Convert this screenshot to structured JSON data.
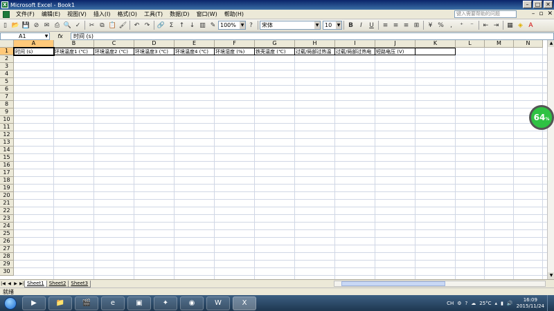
{
  "window": {
    "title": "Microsoft Excel - Book1",
    "app_letter": "X"
  },
  "menu": {
    "items": [
      "文件(F)",
      "编辑(E)",
      "视图(V)",
      "插入(I)",
      "格式(O)",
      "工具(T)",
      "数据(D)",
      "窗口(W)",
      "帮助(H)"
    ],
    "help_placeholder": "键入需要帮助的问题"
  },
  "toolbar": {
    "zoom": "100%",
    "font": "宋体",
    "font_size": "10",
    "bold": "B",
    "italic": "I",
    "underline": "U",
    "percent": "%",
    "sum": "Σ"
  },
  "formula_bar": {
    "name_box": "A1",
    "fx": "fx",
    "content": "时间 (s)"
  },
  "sheet": {
    "columns": [
      "A",
      "B",
      "C",
      "D",
      "E",
      "F",
      "G",
      "H",
      "I",
      "J",
      "K",
      "L",
      "M",
      "N"
    ],
    "rows": [
      "1",
      "2",
      "3",
      "4",
      "5",
      "6",
      "7",
      "8",
      "9",
      "10",
      "11",
      "12",
      "13",
      "14",
      "15",
      "16",
      "17",
      "18",
      "19",
      "20",
      "21",
      "22",
      "23",
      "24",
      "25",
      "26",
      "27",
      "28",
      "29",
      "30"
    ],
    "row1": [
      "时间 (s)",
      "环境温度1 (℃)",
      "环境温度2 (℃)",
      "环境温度3 (℃)",
      "环境温度4 (℃)",
      "环境湿度 (%)",
      "铁壳温度 (℃)",
      "过载/局部过热温",
      "过载/局部过热电",
      "短路电压 (V)",
      ""
    ]
  },
  "badge": {
    "value": "64",
    "unit": "%"
  },
  "tabs": [
    "Sheet1",
    "Sheet2",
    "Sheet3"
  ],
  "status": "就绪",
  "taskbar": {
    "lang": "CH",
    "temperature": "25°C",
    "time": "16:09",
    "date": "2015/11/24"
  }
}
